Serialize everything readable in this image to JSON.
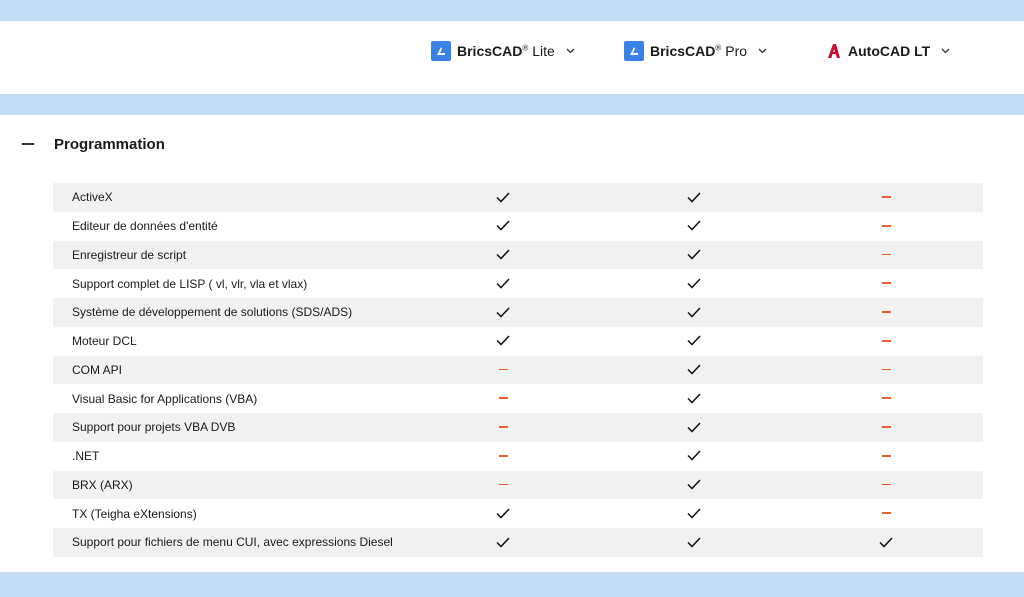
{
  "products": [
    {
      "brand": "BricsCAD",
      "mark": "®",
      "variant": "Lite",
      "icon": "bricscad-logo-icon"
    },
    {
      "brand": "BricsCAD",
      "mark": "®",
      "variant": "Pro",
      "icon": "bricscad-logo-icon"
    },
    {
      "brand": "AutoCAD LT",
      "mark": "",
      "variant": "",
      "icon": "autocad-logo-icon"
    }
  ],
  "section": {
    "toggle": "−",
    "title": "Programmation"
  },
  "colors": {
    "band": "#c3dbf4",
    "bricscad_blue": "#3b82e6",
    "autocad_red": "#c8102e",
    "dash_orange": "#ee5d2b",
    "row_shade": "#f1f1f1"
  },
  "features": [
    {
      "label": "ActiveX",
      "lite": true,
      "pro": true,
      "acad": false
    },
    {
      "label": "Editeur de données d'entité",
      "lite": true,
      "pro": true,
      "acad": false
    },
    {
      "label": "Enregistreur de script",
      "lite": true,
      "pro": true,
      "acad": false
    },
    {
      "label": "Support complet de LISP ( vl, vlr, vla et vlax)",
      "lite": true,
      "pro": true,
      "acad": false
    },
    {
      "label": "Système de développement de solutions (SDS/ADS)",
      "lite": true,
      "pro": true,
      "acad": false
    },
    {
      "label": "Moteur DCL",
      "lite": true,
      "pro": true,
      "acad": false
    },
    {
      "label": "COM API",
      "lite": false,
      "pro": true,
      "acad": false
    },
    {
      "label": "Visual Basic for Applications (VBA)",
      "lite": false,
      "pro": true,
      "acad": false
    },
    {
      "label": "Support pour projets VBA DVB",
      "lite": false,
      "pro": true,
      "acad": false
    },
    {
      "label": ".NET",
      "lite": false,
      "pro": true,
      "acad": false
    },
    {
      "label": "BRX (ARX)",
      "lite": false,
      "pro": true,
      "acad": false
    },
    {
      "label": "TX (Teigha eXtensions)",
      "lite": true,
      "pro": true,
      "acad": false
    },
    {
      "label": "Support pour fichiers de menu CUI, avec expressions Diesel",
      "lite": true,
      "pro": true,
      "acad": true
    }
  ]
}
